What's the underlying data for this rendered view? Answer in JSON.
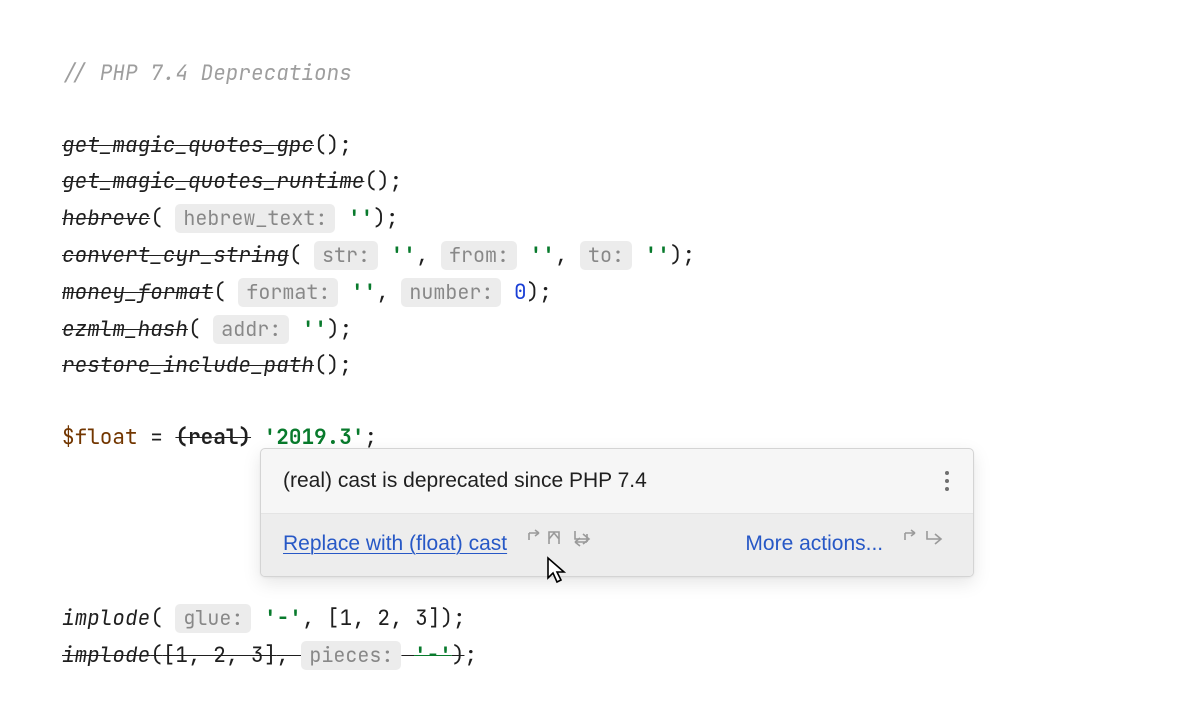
{
  "code": {
    "comment": "// PHP 7.4 Deprecations",
    "funcs": {
      "get_magic_quotes_gpc": "get_magic_quotes_gpc",
      "get_magic_quotes_runtime": "get_magic_quotes_runtime",
      "hebrevc": "hebrevc",
      "convert_cyr_string": "convert_cyr_string",
      "money_format": "money_format",
      "ezmlm_hash": "ezmlm_hash",
      "restore_include_path": "restore_include_path",
      "implode": "implode",
      "implode2": "implode"
    },
    "hints": {
      "hebrew_text": "hebrew_text:",
      "str": "str:",
      "from": "from:",
      "to": "to:",
      "format": "format:",
      "number": "number:",
      "addr": "addr:",
      "glue": "glue:",
      "pieces": "pieces:"
    },
    "values": {
      "empty": "''",
      "zero": "0",
      "float_var": "$float",
      "real_cast": "(real)",
      "year_str": "'2019.3'",
      "dash": "'-'",
      "arr": "[1, 2, 3]"
    }
  },
  "tooltip": {
    "message": "(real) cast is deprecated since PHP 7.4",
    "fix": "Replace with (float) cast",
    "more": "More actions..."
  }
}
